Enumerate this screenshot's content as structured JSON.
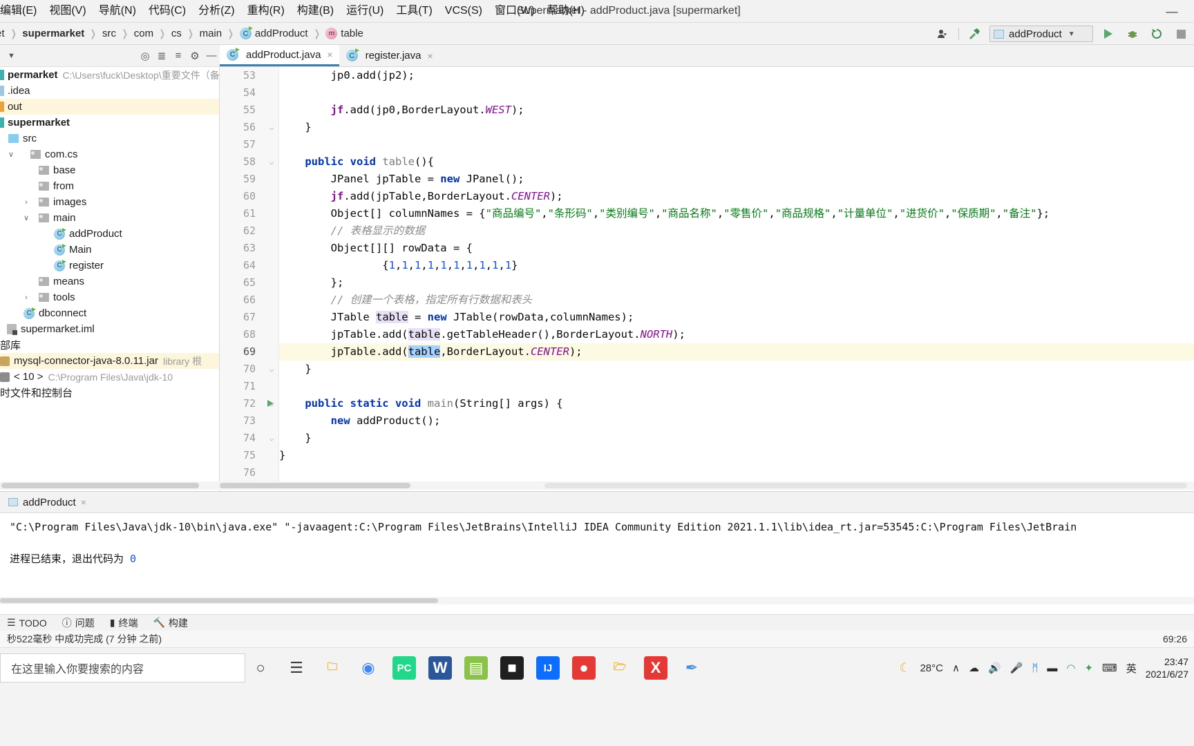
{
  "window": {
    "title": "Supermarket - addProduct.java [supermarket]",
    "minimize_label": "—"
  },
  "menubar": {
    "items": [
      {
        "label": "编辑(E)",
        "name": "menu-edit"
      },
      {
        "label": "视图(V)",
        "name": "menu-view"
      },
      {
        "label": "导航(N)",
        "name": "menu-navigate"
      },
      {
        "label": "代码(C)",
        "name": "menu-code"
      },
      {
        "label": "分析(Z)",
        "name": "menu-analyze"
      },
      {
        "label": "重构(R)",
        "name": "menu-refactor"
      },
      {
        "label": "构建(B)",
        "name": "menu-build"
      },
      {
        "label": "运行(U)",
        "name": "menu-run"
      },
      {
        "label": "工具(T)",
        "name": "menu-tools"
      },
      {
        "label": "VCS(S)",
        "name": "menu-vcs"
      },
      {
        "label": "窗口(W)",
        "name": "menu-window"
      },
      {
        "label": "帮助(H)",
        "name": "menu-help"
      }
    ]
  },
  "breadcrumb": {
    "items": [
      {
        "label": "et",
        "icon": "",
        "bold": false
      },
      {
        "label": "supermarket",
        "icon": "",
        "bold": true
      },
      {
        "label": "src",
        "icon": "",
        "bold": false
      },
      {
        "label": "com",
        "icon": "",
        "bold": false
      },
      {
        "label": "cs",
        "icon": "",
        "bold": false
      },
      {
        "label": "main",
        "icon": "",
        "bold": false
      },
      {
        "label": "addProduct",
        "icon": "class-icon",
        "bold": false
      },
      {
        "label": "table",
        "icon": "method-icon",
        "bold": false
      }
    ]
  },
  "toolbar": {
    "run_config_label": "addProduct",
    "run_button_name": "run-button",
    "debug_button_name": "debug-button",
    "rerun_button_name": "rerun-button",
    "stop_button_name": "stop-button"
  },
  "project_tree": {
    "rows": [
      {
        "label": "permarket",
        "suffix": "C:\\Users\\fuck\\Desktop\\重要文件（备",
        "indent": 0,
        "icon": "bar-teal",
        "twisty": "",
        "bold": true,
        "highlight": false
      },
      {
        "label": ".idea",
        "suffix": "",
        "indent": 0,
        "icon": "bar-blue",
        "twisty": "",
        "bold": false,
        "highlight": false
      },
      {
        "label": "out",
        "suffix": "",
        "indent": 0,
        "icon": "bar-orange",
        "twisty": "",
        "bold": false,
        "highlight": true
      },
      {
        "label": "supermarket",
        "suffix": "",
        "indent": 0,
        "icon": "bar-teal",
        "twisty": "",
        "bold": true,
        "highlight": false
      },
      {
        "label": "src",
        "suffix": "",
        "indent": 1,
        "icon": "folder-blue",
        "twisty": "",
        "bold": false,
        "highlight": false
      },
      {
        "label": "com.cs",
        "suffix": "",
        "indent": 2,
        "icon": "folder",
        "twisty": "∨",
        "bold": false,
        "highlight": false
      },
      {
        "label": "base",
        "suffix": "",
        "indent": 3,
        "icon": "folder",
        "twisty": "",
        "bold": false,
        "highlight": false
      },
      {
        "label": "from",
        "suffix": "",
        "indent": 3,
        "icon": "folder",
        "twisty": "",
        "bold": false,
        "highlight": false
      },
      {
        "label": "images",
        "suffix": "",
        "indent": 3,
        "icon": "folder",
        "twisty": "›",
        "bold": false,
        "highlight": false
      },
      {
        "label": "main",
        "suffix": "",
        "indent": 3,
        "icon": "folder",
        "twisty": "∨",
        "bold": false,
        "highlight": false
      },
      {
        "label": "addProduct",
        "suffix": "",
        "indent": 4,
        "icon": "class",
        "twisty": "",
        "bold": false,
        "highlight": false
      },
      {
        "label": "Main",
        "suffix": "",
        "indent": 4,
        "icon": "class",
        "twisty": "",
        "bold": false,
        "highlight": false
      },
      {
        "label": "register",
        "suffix": "",
        "indent": 4,
        "icon": "class",
        "twisty": "",
        "bold": false,
        "highlight": false
      },
      {
        "label": "means",
        "suffix": "",
        "indent": 3,
        "icon": "folder",
        "twisty": "",
        "bold": false,
        "highlight": false
      },
      {
        "label": "tools",
        "suffix": "",
        "indent": 3,
        "icon": "folder",
        "twisty": "›",
        "bold": false,
        "highlight": false
      },
      {
        "label": "dbconnect",
        "suffix": "",
        "indent": 2,
        "icon": "class",
        "twisty": "",
        "bold": false,
        "highlight": false
      },
      {
        "label": "supermarket.iml",
        "suffix": "",
        "indent": 1,
        "icon": "module",
        "twisty": "",
        "bold": false,
        "highlight": false
      },
      {
        "label": "部库",
        "suffix": "",
        "indent": 0,
        "icon": "none",
        "twisty": "",
        "bold": false,
        "highlight": false
      },
      {
        "label": "mysql-connector-java-8.0.11.jar",
        "suffix": "library 根",
        "indent": 0,
        "icon": "jar",
        "twisty": "",
        "bold": false,
        "highlight": true
      },
      {
        "label": "< 10 >",
        "suffix": "C:\\Program Files\\Java\\jdk-10",
        "indent": 0,
        "icon": "sdk",
        "twisty": "",
        "bold": false,
        "highlight": false
      },
      {
        "label": "时文件和控制台",
        "suffix": "",
        "indent": 0,
        "icon": "none",
        "twisty": "",
        "bold": false,
        "highlight": false
      }
    ]
  },
  "editor_tabs": [
    {
      "label": "addProduct.java",
      "icon": "class-icon",
      "active": true,
      "close": "×"
    },
    {
      "label": "register.java",
      "icon": "class-icon",
      "active": false,
      "close": "×"
    }
  ],
  "code": {
    "first_line": 53,
    "lines": [
      {
        "n": 53,
        "html": "        jp0.add(jp2);",
        "fold": "",
        "current": false
      },
      {
        "n": 54,
        "html": "",
        "fold": "",
        "current": false
      },
      {
        "n": 55,
        "html": "        <span class=\"fld\">jf</span>.add(jp0,BorderLayout.<span class=\"stc\">WEST</span>);",
        "fold": "",
        "current": false
      },
      {
        "n": 56,
        "html": "    }",
        "fold": "⌵",
        "current": false
      },
      {
        "n": 57,
        "html": "",
        "fold": "",
        "current": false
      },
      {
        "n": 58,
        "html": "    <span class=\"kw\">public void</span> <span class=\"mth\">table</span>(){",
        "fold": "⌵",
        "current": false
      },
      {
        "n": 59,
        "html": "        JPanel jpTable = <span class=\"kw\">new</span> JPanel();",
        "fold": "",
        "current": false
      },
      {
        "n": 60,
        "html": "        <span class=\"fld\">jf</span>.add(jpTable,BorderLayout.<span class=\"stc\">CENTER</span>);",
        "fold": "",
        "current": false
      },
      {
        "n": 61,
        "html": "        Object[] columnNames = {<span class=\"str\">\"商品编号\"</span>,<span class=\"str\">\"条形码\"</span>,<span class=\"str\">\"类别编号\"</span>,<span class=\"str\">\"商品名称\"</span>,<span class=\"str\">\"零售价\"</span>,<span class=\"str\">\"商品规格\"</span>,<span class=\"str\">\"计量单位\"</span>,<span class=\"str\">\"进货价\"</span>,<span class=\"str\">\"保质期\"</span>,<span class=\"str\">\"备注\"</span>};",
        "fold": "",
        "current": false
      },
      {
        "n": 62,
        "html": "        <span class=\"cmt\">// 表格显示的数据</span>",
        "fold": "",
        "current": false
      },
      {
        "n": 63,
        "html": "        Object[][] rowData = {",
        "fold": "",
        "current": false
      },
      {
        "n": 64,
        "html": "                {<span class=\"num\">1</span>,<span class=\"num\">1</span>,<span class=\"num\">1</span>,<span class=\"num\">1</span>,<span class=\"num\">1</span>,<span class=\"num\">1</span>,<span class=\"num\">1</span>,<span class=\"num\">1</span>,<span class=\"num\">1</span>,<span class=\"num\">1</span>}",
        "fold": "",
        "current": false
      },
      {
        "n": 65,
        "html": "        };",
        "fold": "",
        "current": false
      },
      {
        "n": 66,
        "html": "        <span class=\"cmt\">// 创建一个表格，指定所有行数据和表头</span>",
        "fold": "",
        "current": false
      },
      {
        "n": 67,
        "html": "        JTable <span class=\"ident-hl\">table</span> = <span class=\"kw\">new</span> JTable(rowData,columnNames);",
        "fold": "",
        "current": false
      },
      {
        "n": 68,
        "html": "        jpTable.add(<span class=\"ident-hl\">table</span>.getTableHeader(),BorderLayout.<span class=\"stc\">NORTH</span>);",
        "fold": "",
        "current": false
      },
      {
        "n": 69,
        "html": "        jpTable.add(<span class=\"sel-hl\">table</span>,BorderLayout.<span class=\"stc\">CENTER</span>);",
        "fold": "",
        "current": true
      },
      {
        "n": 70,
        "html": "    }",
        "fold": "⌵",
        "current": false
      },
      {
        "n": 71,
        "html": "",
        "fold": "",
        "current": false
      },
      {
        "n": 72,
        "html": "    <span class=\"kw\">public static void</span> <span class=\"mth\">main</span>(String[] args) {",
        "fold": "⌵",
        "current": false,
        "run_marker": true
      },
      {
        "n": 73,
        "html": "        <span class=\"kw\">new</span> addProduct();",
        "fold": "",
        "current": false
      },
      {
        "n": 74,
        "html": "    }",
        "fold": "⌵",
        "current": false
      },
      {
        "n": 75,
        "html": "}",
        "fold": "",
        "current": false
      },
      {
        "n": 76,
        "html": "",
        "fold": "",
        "current": false
      }
    ]
  },
  "run_panel": {
    "tab_label": "addProduct",
    "tab_close": "×",
    "console_line1": "\"C:\\Program Files\\Java\\jdk-10\\bin\\java.exe\" \"-javaagent:C:\\Program Files\\JetBrains\\IntelliJ IDEA Community Edition 2021.1.1\\lib\\idea_rt.jar=53545:C:\\Program Files\\JetBrain",
    "console_line2_text": "进程已结束，退出代码为",
    "console_line2_code": "0"
  },
  "status_bar": {
    "items": [
      {
        "label": "TODO",
        "name": "status-todo",
        "icon": "list-icon"
      },
      {
        "label": "问题",
        "name": "status-problems",
        "icon": "warning-icon"
      },
      {
        "label": "终端",
        "name": "status-terminal",
        "icon": "terminal-icon"
      },
      {
        "label": "构建",
        "name": "status-build",
        "icon": "hammer-icon"
      }
    ],
    "build_message": "秒522毫秒 中成功完成 (7 分钟 之前)",
    "caret_position": "69:26"
  },
  "taskbar": {
    "search_placeholder": "在这里输入你要搜索的内容",
    "apps": [
      {
        "name": "cortana-icon",
        "glyph": "○",
        "color": "#3b3b3b",
        "bg": "transparent"
      },
      {
        "name": "task-view-icon",
        "glyph": "☰",
        "color": "#3b3b3b",
        "bg": "transparent"
      },
      {
        "name": "file-explorer-icon",
        "glyph": "🗀",
        "color": "#f0b429",
        "bg": "transparent"
      },
      {
        "name": "chrome-icon",
        "glyph": "◉",
        "color": "#4285f4",
        "bg": "transparent"
      },
      {
        "name": "pycharm-icon",
        "glyph": "PC",
        "color": "#ffffff",
        "bg": "#21d789"
      },
      {
        "name": "word-icon",
        "glyph": "W",
        "color": "#ffffff",
        "bg": "#2b579a"
      },
      {
        "name": "notepad-icon",
        "glyph": "▤",
        "color": "#ffffff",
        "bg": "#8bc34a"
      },
      {
        "name": "terminal-icon",
        "glyph": "■",
        "color": "#ffffff",
        "bg": "#1f1f1f"
      },
      {
        "name": "intellij-icon",
        "glyph": "IJ",
        "color": "#ffffff",
        "bg": "#0d6efd"
      },
      {
        "name": "record-icon",
        "glyph": "●",
        "color": "#ffffff",
        "bg": "#e53935"
      },
      {
        "name": "folder-icon",
        "glyph": "🗁",
        "color": "#f0b429",
        "bg": "transparent"
      },
      {
        "name": "wps-icon",
        "glyph": "X",
        "color": "#ffffff",
        "bg": "#e53935"
      },
      {
        "name": "tool-icon",
        "glyph": "✒",
        "color": "#4a90d9",
        "bg": "transparent"
      }
    ],
    "tray": {
      "weather_glyph": "☾",
      "temperature": "28°C",
      "chevron": "∧",
      "icons": [
        {
          "name": "onedrive-icon",
          "glyph": "☁"
        },
        {
          "name": "volume-icon",
          "glyph": "🔊"
        },
        {
          "name": "mic-icon",
          "glyph": "🎤"
        },
        {
          "name": "bluetooth-icon",
          "glyph": "ᛗ"
        },
        {
          "name": "battery-icon",
          "glyph": "▬"
        },
        {
          "name": "wifi-icon",
          "glyph": "◠"
        },
        {
          "name": "shield-icon",
          "glyph": "✦"
        },
        {
          "name": "keyboard-icon",
          "glyph": "⌨"
        }
      ],
      "ime_label": "英",
      "time": "23:47",
      "date": "2021/6/27"
    }
  }
}
